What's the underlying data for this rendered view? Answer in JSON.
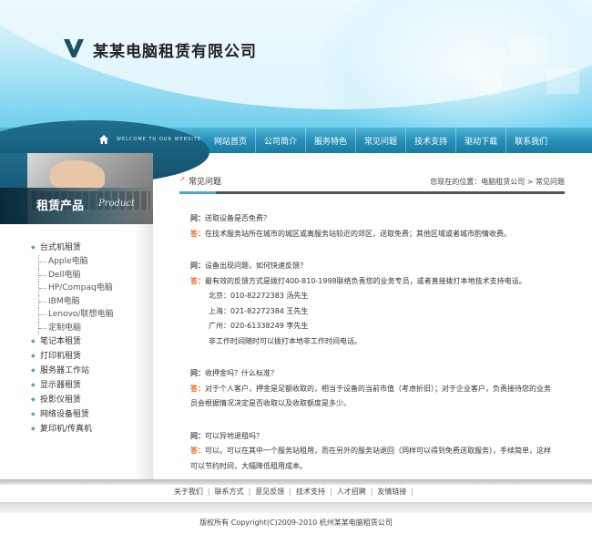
{
  "header": {
    "company_name": "某某电脑租赁有限公司",
    "logo_icon": "w-logo-icon"
  },
  "nav": {
    "welcome_text": "WELCOME TO OUR WEBSITE",
    "home_icon": "home-icon",
    "items": [
      {
        "label": "网站首页"
      },
      {
        "label": "公司简介"
      },
      {
        "label": "服务特色"
      },
      {
        "label": "常见问题"
      },
      {
        "label": "技术支持"
      },
      {
        "label": "驱动下载"
      },
      {
        "label": "联系我们"
      }
    ]
  },
  "sidebar": {
    "banner_title": "租赁产品",
    "banner_subtitle": "Product",
    "menu": [
      {
        "label": "台式机租赁",
        "type": "cat"
      },
      {
        "label": "Apple电脑",
        "type": "sub"
      },
      {
        "label": "Dell电脑",
        "type": "sub"
      },
      {
        "label": "HP/Compaq电脑",
        "type": "sub"
      },
      {
        "label": "IBM电脑",
        "type": "sub"
      },
      {
        "label": "Lenovo/联想电脑",
        "type": "sub"
      },
      {
        "label": "定制电脑",
        "type": "sub"
      },
      {
        "label": "笔记本租赁",
        "type": "cat"
      },
      {
        "label": "打印机租赁",
        "type": "cat"
      },
      {
        "label": "服务器工作站",
        "type": "cat"
      },
      {
        "label": "显示器租赁",
        "type": "cat"
      },
      {
        "label": "投影仪租赁",
        "type": "cat"
      },
      {
        "label": "网络设备租赁",
        "type": "cat"
      },
      {
        "label": "复印机/传真机",
        "type": "cat"
      }
    ]
  },
  "main": {
    "section_title": "常见问题",
    "breadcrumb_prefix": "您现在的位置：",
    "breadcrumb_home": "电脑租赁公司",
    "breadcrumb_sep": " > ",
    "breadcrumb_current": "常见问题",
    "q_marker": "问：",
    "a_marker": "答：",
    "faq": [
      {
        "q": "送取设备是否免费？",
        "a": "在技术服务站所在城市的城区或离服务站较近的郊区，送取免费；其他区域或者城市酌情收费。",
        "extra": []
      },
      {
        "q": "设备出现问题，如何快速反馈？",
        "a": "最有效的反馈方式是拨打400-810-1998联络负责您的业务专员，或者直接拨打本地技术支持电话。",
        "extra": [
          "北京：010-82272383 汤先生",
          "上海：021-82272384 王先生",
          "广州：020-61338249 李先生",
          "非工作时间随时可以拨打本地非工作时间电话。"
        ]
      },
      {
        "q": "收押金吗？什么标准？",
        "a": "对于个人客户，押金是足额收取的，相当于设备的当前市值（考虑折旧）；对于企业客户，负责接待您的业务员会根据情况决定是否收取以及收取额度是多少。",
        "extra": []
      },
      {
        "q": "可以异地退租吗？",
        "a": "可以。可以在其中一个服务站租用，而在另外的服务站退回（同样可以得到免费送取服务），手续简单，这样可以节约时间，大幅降低租用成本。",
        "extra": []
      }
    ]
  },
  "footer": {
    "links": [
      "关于我们",
      "联系方式",
      "意见反馈",
      "技术支持",
      "人才招聘",
      "友情链接"
    ],
    "separator": "|",
    "copyright": "版权所有  Copyright(C)2009-2010 杭州某某电脑租赁公司"
  }
}
